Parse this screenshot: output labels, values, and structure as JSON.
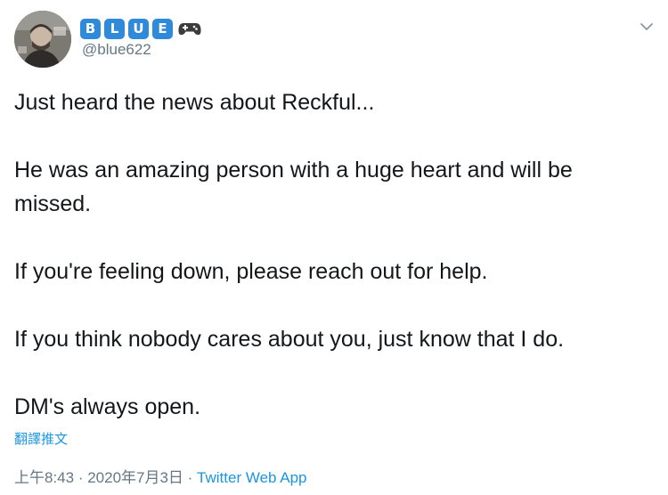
{
  "user": {
    "display_name_letters": [
      "B",
      "L",
      "U",
      "E"
    ],
    "name_emoji_icon": "gamepad-icon",
    "handle": "@blue622",
    "avatar_icon": "profile-photo"
  },
  "menu": {
    "icon": "chevron-down-icon"
  },
  "tweet": {
    "paragraphs": [
      "Just heard the news about Reckful...",
      "He was an amazing person with a huge heart and will be missed.",
      "If you're feeling down, please reach out for help.",
      "If you think nobody cares about you, just know that I do.",
      "DM's always open."
    ],
    "translate_label": "翻譯推文"
  },
  "meta": {
    "time": "上午8:43",
    "separator": " · ",
    "date": "2020年7月3日",
    "separator2": " · ",
    "source": "Twitter Web App"
  },
  "colors": {
    "link": "#1b95e0",
    "secondary_text": "#657786",
    "primary_text": "#14171a",
    "name_badge": "#2f8ad9"
  }
}
